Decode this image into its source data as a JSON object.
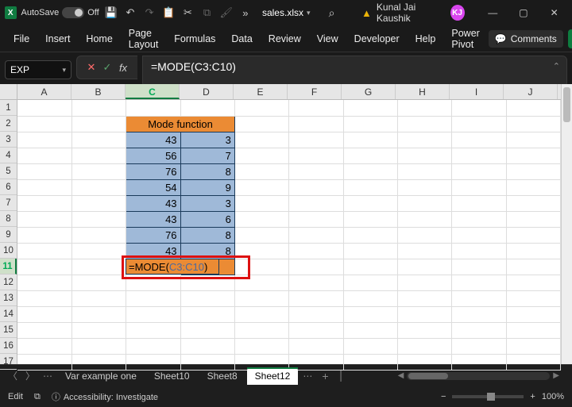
{
  "titlebar": {
    "autosave_label": "AutoSave",
    "autosave_state": "Off",
    "filename": "sales.xlsx",
    "username": "Kunal Jai Kaushik",
    "avatar": "KJ"
  },
  "menu": {
    "items": [
      "File",
      "Insert",
      "Home",
      "Page Layout",
      "Formulas",
      "Data",
      "Review",
      "View",
      "Developer",
      "Help",
      "Power Pivot"
    ],
    "comments": "Comments"
  },
  "formulabar": {
    "namebox": "EXP",
    "formula": "=MODE(C3:C10)"
  },
  "columns": [
    "A",
    "B",
    "C",
    "D",
    "E",
    "F",
    "G",
    "H",
    "I",
    "J"
  ],
  "rows_count": 17,
  "active_col": "C",
  "active_row": 11,
  "sheet": {
    "header": "Mode function",
    "col_c": [
      "43",
      "56",
      "76",
      "54",
      "43",
      "43",
      "76",
      "43"
    ],
    "col_d": [
      "3",
      "7",
      "8",
      "9",
      "3",
      "6",
      "8",
      "8"
    ],
    "editing_prefix": "=MODE(",
    "editing_range": "C3:C10",
    "editing_suffix": ")"
  },
  "tabs": {
    "items": [
      "Var example one",
      "Sheet10",
      "Sheet8",
      "Sheet12"
    ],
    "active": "Sheet12"
  },
  "status": {
    "mode": "Edit",
    "accessibility": "Accessibility: Investigate",
    "zoom": "100%"
  }
}
